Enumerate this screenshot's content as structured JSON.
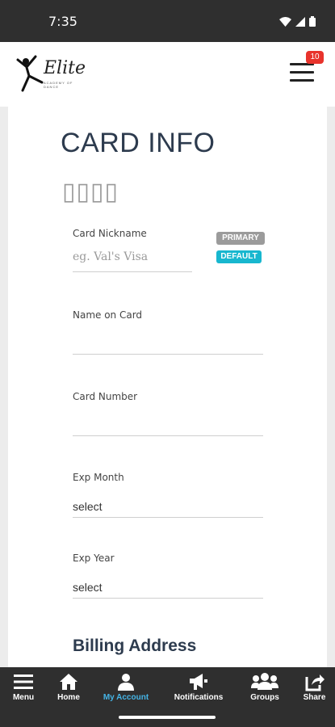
{
  "status_bar": {
    "time": "7:35",
    "icons": [
      "wifi-icon",
      "signal-icon",
      "battery-icon"
    ]
  },
  "header": {
    "logo_text": "Elite",
    "logo_subtext": "ACADEMY OF DANCE",
    "menu_badge": "10"
  },
  "card": {
    "title": "CARD INFO",
    "card_glyphs": "▯▯▯▯",
    "badges": {
      "primary": "PRIMARY",
      "default": "DEFAULT"
    },
    "fields": {
      "nickname": {
        "label": "Card Nickname",
        "placeholder": "eg. Val's Visa",
        "value": ""
      },
      "name_on_card": {
        "label": "Name on Card",
        "value": ""
      },
      "card_number": {
        "label": "Card Number",
        "value": ""
      },
      "exp_month": {
        "label": "Exp Month",
        "value": "select"
      },
      "exp_year": {
        "label": "Exp Year",
        "value": "select"
      }
    },
    "billing_heading": "Billing Address"
  },
  "bottom_nav": {
    "items": [
      {
        "label": "Menu",
        "icon": "hamburger-icon"
      },
      {
        "label": "Home",
        "icon": "home-icon"
      },
      {
        "label": "My Account",
        "icon": "user-icon",
        "active": true
      },
      {
        "label": "Notifications",
        "icon": "megaphone-icon"
      },
      {
        "label": "Groups",
        "icon": "groups-icon"
      },
      {
        "label": "Share",
        "icon": "share-icon"
      }
    ]
  },
  "colors": {
    "accent": "#45b4e6",
    "badge_red": "#e8332c",
    "primary_pill": "#9b9b9b",
    "default_pill": "#18b7cf",
    "title": "#2d3b4e"
  }
}
